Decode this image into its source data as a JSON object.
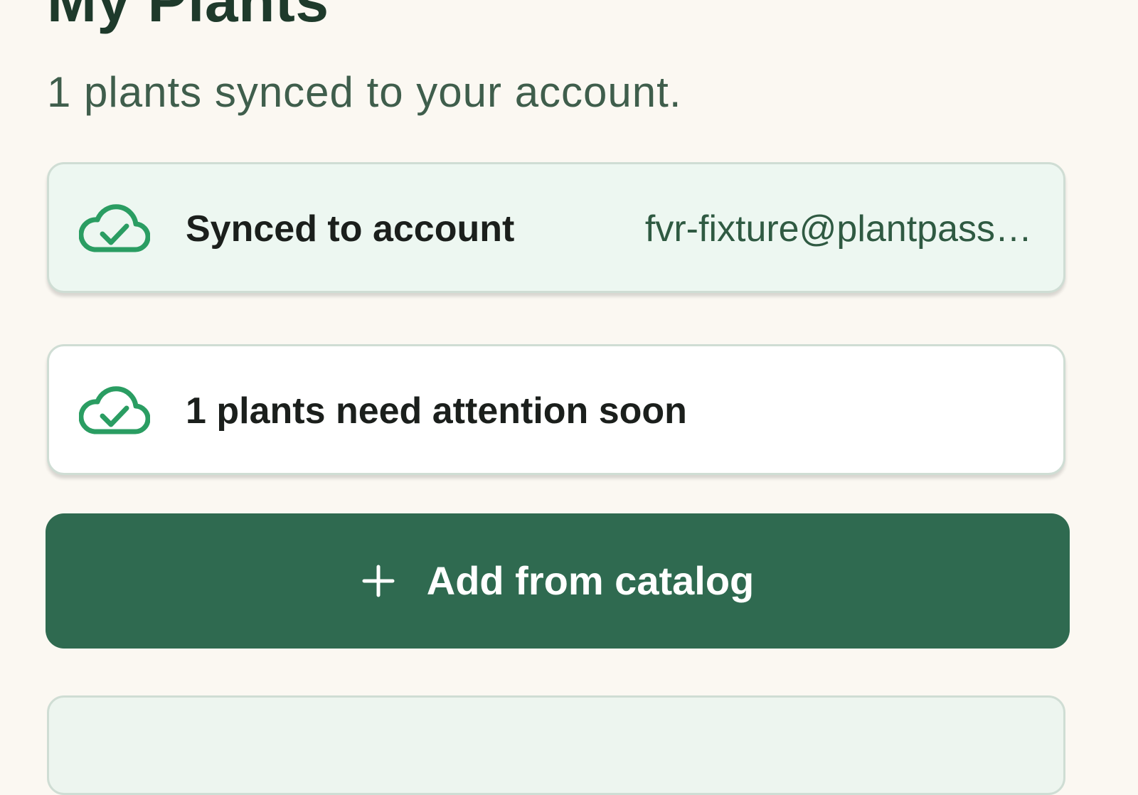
{
  "page": {
    "title": "My Plants",
    "subtitle": "1 plants synced to your account."
  },
  "sync_card": {
    "icon": "cloud-check-icon",
    "label": "Synced to account",
    "account": "fvr-fixture@plantpass…"
  },
  "attention_card": {
    "icon": "cloud-check-icon",
    "label": "1 plants need attention soon"
  },
  "add_button": {
    "icon": "plus-icon",
    "label": "Add from catalog"
  },
  "colors": {
    "background": "#fbf8f2",
    "primary": "#2f6a50",
    "icon_green": "#2a9d62",
    "sync_card_bg": "#edf7f1",
    "title_text": "#1e3a2b"
  }
}
